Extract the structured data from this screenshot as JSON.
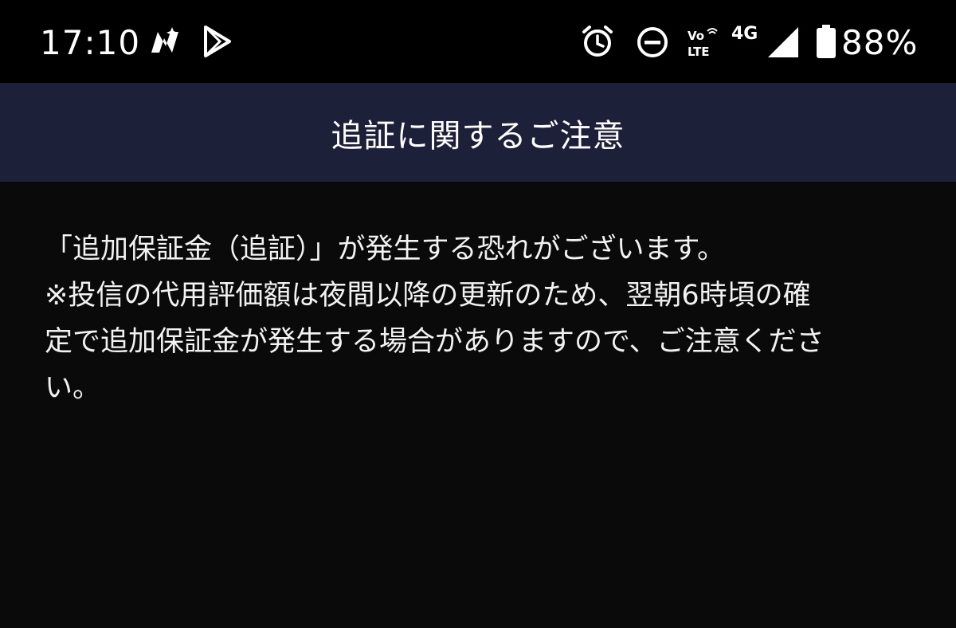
{
  "status_bar": {
    "time": "17:10",
    "battery_percent": "88%",
    "network_type": "4G",
    "volte": {
      "top": "Vo",
      "bottom": "LTE"
    },
    "icons": [
      "sbi-app-icon",
      "play-store-icon",
      "alarm-icon",
      "do-not-disturb-icon",
      "volte-icon",
      "signal-icon",
      "battery-icon"
    ]
  },
  "header": {
    "title": "追証に関するご注意"
  },
  "content": {
    "notice": "「追加保証金（追証）」が発生する恐れがございます。",
    "note_lines": [
      "※投信の代用評価額は夜間以降の更新のため、翌朝6時頃の確",
      "定で追加保証金が発生する場合がありますので、ご注意くださ",
      "い。"
    ]
  },
  "colors": {
    "status_bar_bg": "#000000",
    "title_bar_bg": "#1c2038",
    "page_bg": "#0a0a0a",
    "text": "#f2f2f2"
  }
}
